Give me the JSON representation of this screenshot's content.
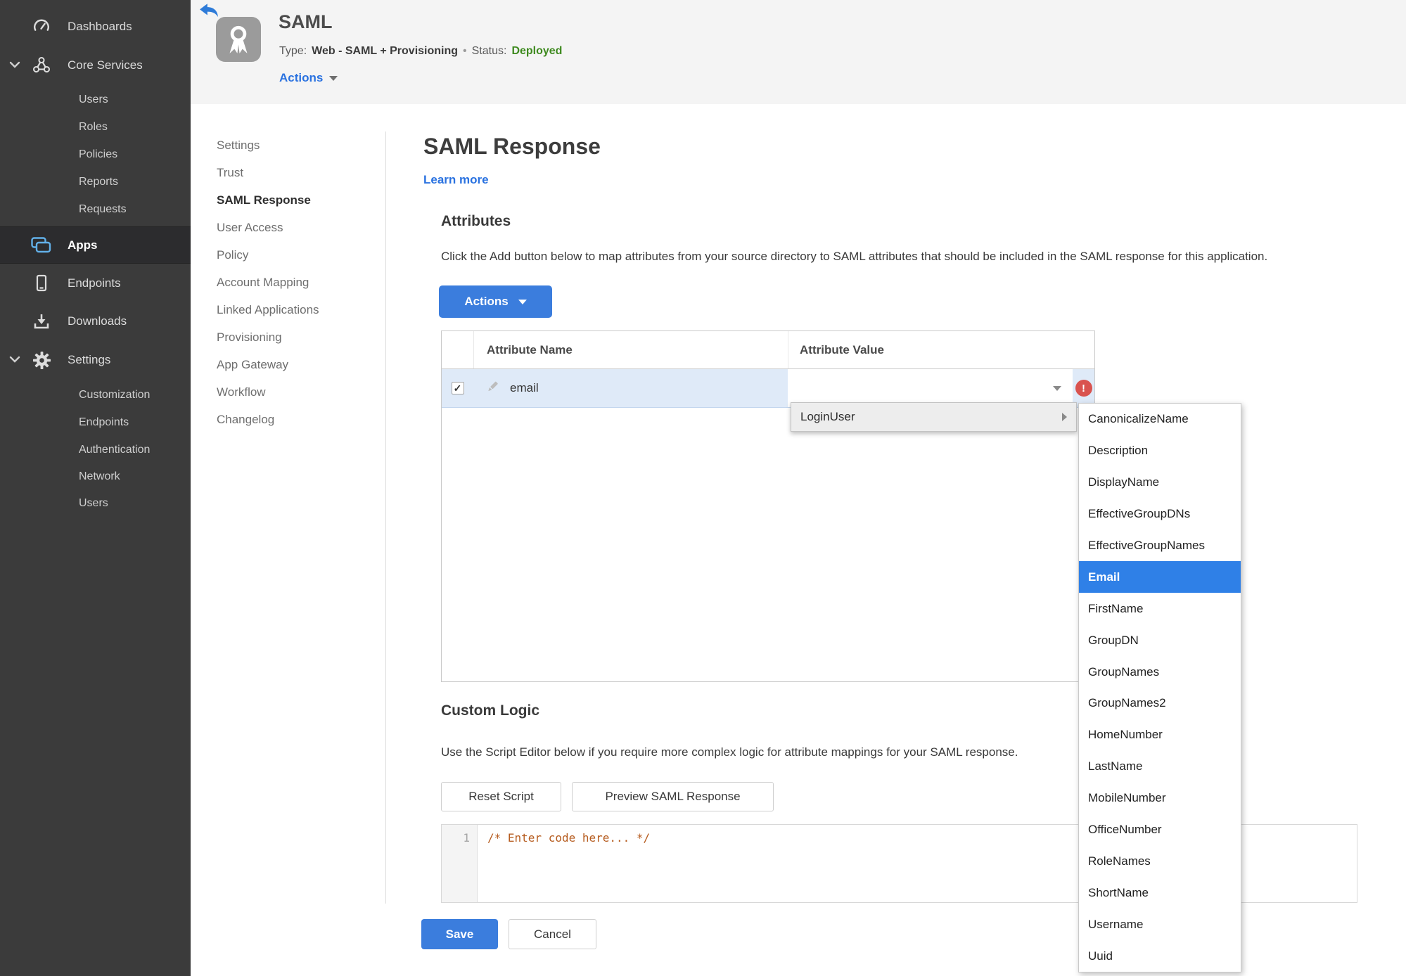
{
  "sidebar": {
    "items": [
      {
        "label": "Dashboards"
      },
      {
        "label": "Core Services"
      },
      {
        "label": "Users"
      },
      {
        "label": "Roles"
      },
      {
        "label": "Policies"
      },
      {
        "label": "Reports"
      },
      {
        "label": "Requests"
      },
      {
        "label": "Apps"
      },
      {
        "label": "Endpoints"
      },
      {
        "label": "Downloads"
      },
      {
        "label": "Settings"
      },
      {
        "label": "Customization"
      },
      {
        "label": "Endpoints"
      },
      {
        "label": "Authentication"
      },
      {
        "label": "Network"
      },
      {
        "label": "Users"
      }
    ]
  },
  "header": {
    "title": "SAML",
    "type_label": "Type:",
    "type_value": "Web - SAML + Provisioning",
    "separator": "•",
    "status_label": "Status:",
    "status_value": "Deployed",
    "actions_label": "Actions"
  },
  "subnav": {
    "items": [
      {
        "label": "Settings"
      },
      {
        "label": "Trust"
      },
      {
        "label": "SAML Response"
      },
      {
        "label": "User Access"
      },
      {
        "label": "Policy"
      },
      {
        "label": "Account Mapping"
      },
      {
        "label": "Linked Applications"
      },
      {
        "label": "Provisioning"
      },
      {
        "label": "App Gateway"
      },
      {
        "label": "Workflow"
      },
      {
        "label": "Changelog"
      }
    ]
  },
  "main": {
    "title": "SAML Response",
    "learn_more": "Learn more",
    "attributes": {
      "heading": "Attributes",
      "description": "Click the Add button below to map attributes from your source directory to SAML attributes that should be included in the SAML response for this application.",
      "actions_button": "Actions",
      "table": {
        "columns": [
          "Attribute Name",
          "Attribute Value"
        ],
        "rows": [
          {
            "name": "email",
            "value": "",
            "checked": "✓",
            "error": "!"
          }
        ]
      }
    },
    "value_menu": {
      "item": "LoginUser"
    },
    "attribute_submenu": {
      "selected": "Email",
      "items": [
        "CanonicalizeName",
        "Description",
        "DisplayName",
        "EffectiveGroupDNs",
        "EffectiveGroupNames",
        "Email",
        "FirstName",
        "GroupDN",
        "GroupNames",
        "GroupNames2",
        "HomeNumber",
        "LastName",
        "MobileNumber",
        "OfficeNumber",
        "RoleNames",
        "ShortName",
        "Username",
        "Uuid"
      ]
    },
    "custom_logic": {
      "heading": "Custom Logic",
      "description": "Use the Script Editor below if you require more complex logic for attribute mappings for your SAML response.",
      "reset_button": "Reset Script",
      "preview_button": "Preview SAML Response",
      "editor": {
        "line_number": "1",
        "code": "/* Enter code here... */"
      }
    },
    "footer": {
      "save": "Save",
      "cancel": "Cancel"
    }
  },
  "colors": {
    "accent_blue": "#3b7ddd",
    "link_blue": "#2a72e0",
    "selected_blue": "#2f80e7",
    "row_blue": "#dfeaf8",
    "status_green": "#3e8a1f",
    "error_red": "#d9534f",
    "code_orange": "#b65c1f",
    "sidebar_dark": "#3b3b3b"
  }
}
